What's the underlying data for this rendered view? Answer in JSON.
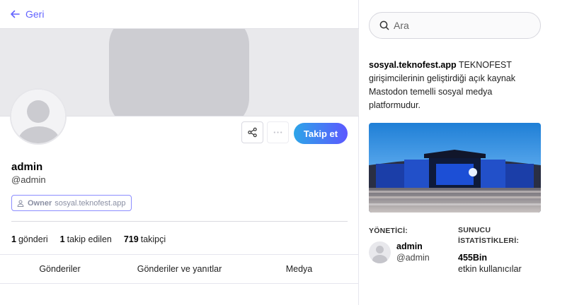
{
  "nav": {
    "back_label": "Geri"
  },
  "profile": {
    "display_name": "admin",
    "handle": "@admin",
    "role": {
      "name": "Owner",
      "domain": "sosyal.teknofest.app"
    },
    "follow_label": "Takip et",
    "stats": [
      {
        "value": "1",
        "label": "gönderi"
      },
      {
        "value": "1",
        "label": "takip edilen"
      },
      {
        "value": "719",
        "label": "takipçi"
      }
    ],
    "tabs": [
      "Gönderiler",
      "Gönderiler ve yanıtlar",
      "Medya"
    ]
  },
  "sidebar": {
    "search": {
      "placeholder": "Ara",
      "value": ""
    },
    "about": {
      "domain": "sosyal.teknofest.app",
      "text": " TEKNOFEST girişimcilerinin geliştirdiği açık kaynak Mastodon temelli sosyal medya platformudur."
    },
    "admin_section": {
      "title": "YÖNETİCİ:",
      "name": "admin",
      "handle": "@admin"
    },
    "server_stats": {
      "title": "SUNUCU İSTATİSTİKLERİ:",
      "value": "455Bin",
      "unit": "etkin kullanıcılar"
    }
  },
  "icons": {
    "back": "arrow-left-icon",
    "share": "share-icon",
    "more": "ellipsis-icon",
    "role": "user-icon",
    "search": "search-icon"
  },
  "colors": {
    "accent": "#6364ff",
    "follow_gradient_start": "#2da5e8",
    "follow_gradient_end": "#5c58ff"
  }
}
